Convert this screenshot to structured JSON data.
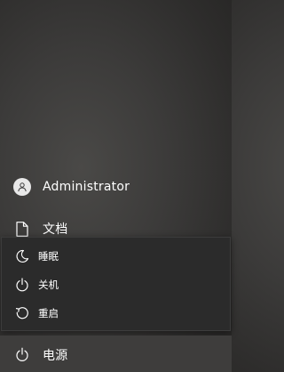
{
  "start_menu": {
    "user": {
      "name": "Administrator",
      "icon": "user-avatar-icon"
    },
    "documents": {
      "label": "文档",
      "icon": "document-icon"
    },
    "power": {
      "label": "电源",
      "icon": "power-icon"
    }
  },
  "power_menu": {
    "items": [
      {
        "label": "睡眠",
        "icon": "moon-icon"
      },
      {
        "label": "关机",
        "icon": "power-icon"
      },
      {
        "label": "重启",
        "icon": "restart-icon"
      }
    ]
  }
}
